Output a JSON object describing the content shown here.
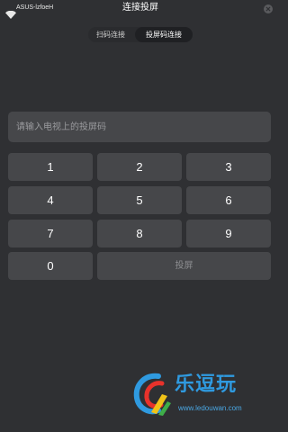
{
  "status_bar": {
    "wifi_icon": "wifi-icon",
    "network_name": "ASUS-lzfoeH"
  },
  "header": {
    "title": "连接投屏",
    "close_icon": "close-icon"
  },
  "tabs": [
    {
      "label": "扫码连接",
      "selected": false
    },
    {
      "label": "投屏码连接",
      "selected": true
    }
  ],
  "code_input": {
    "value": "",
    "placeholder": "请输入电视上的投屏码"
  },
  "keypad": {
    "keys": [
      "1",
      "2",
      "3",
      "4",
      "5",
      "6",
      "7",
      "8",
      "9",
      "0"
    ],
    "cast_label": "投屏",
    "cast_enabled": false
  },
  "watermark": {
    "brand": "乐逗玩",
    "url": "www.ledouwan.com",
    "logo_icon": "ledouwan-logo"
  },
  "colors": {
    "background": "#2f3033",
    "key_background": "#46474a",
    "brand_blue": "#2f9ae0"
  }
}
